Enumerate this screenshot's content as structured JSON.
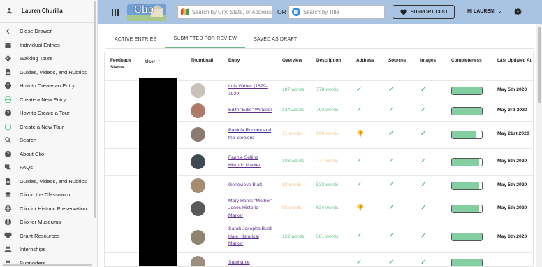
{
  "sidebar": {
    "user_name": "Lauren Churilla",
    "items": [
      {
        "label": "Close Drawer",
        "icon": "chevron-left-icon"
      },
      {
        "label": "Individual Entries",
        "icon": "building-icon"
      },
      {
        "label": "Walking Tours",
        "icon": "direction-sign-icon"
      },
      {
        "label": "Guides, Videos, and Rubrics",
        "icon": "document-icon"
      },
      {
        "label": "How to Create an Entry",
        "icon": "help-circle-icon"
      },
      {
        "label": "Create a New Entry",
        "icon": "add-circle-icon"
      },
      {
        "label": "How to Create a Tour",
        "icon": "help-circle-icon"
      },
      {
        "label": "Create a New Tour",
        "icon": "add-circle-icon"
      },
      {
        "label": "Search",
        "icon": "search-icon"
      },
      {
        "label": "About Clio",
        "icon": "help-circle-icon"
      },
      {
        "label": "FAQs",
        "icon": "forum-icon"
      },
      {
        "label": "Guides, Videos, and Rubrics",
        "icon": "document-icon"
      },
      {
        "label": "Clio in the Classroom",
        "icon": "school-icon"
      },
      {
        "label": "Clio for Historic Preservation",
        "icon": "globe-icon"
      },
      {
        "label": "Clio for Museums",
        "icon": "globe-icon"
      },
      {
        "label": "Grant Resources",
        "icon": "heart-icon"
      },
      {
        "label": "Internships",
        "icon": "people-icon"
      },
      {
        "label": "Supporters",
        "icon": "people-icon"
      }
    ]
  },
  "header": {
    "logo_text": "Clio",
    "search_location_placeholder": "Search by City, State, or Address",
    "or_text": "OR",
    "search_title_placeholder": "Search by Title",
    "support_label": "SUPPORT CLIO",
    "greeting": "HI LAUREN!"
  },
  "tabs": [
    {
      "label": "ACTIVE ENTRIES",
      "active": false
    },
    {
      "label": "SUBMITTED FOR REVIEW",
      "active": true
    },
    {
      "label": "SAVED AS DRAFT",
      "active": false
    }
  ],
  "table": {
    "headers": {
      "feedback": "Feedback Status",
      "user": "User",
      "thumbnail": "Thumbnail",
      "entry": "Entry",
      "overview": "Overview",
      "description": "Description",
      "address": "Address",
      "sources": "Sources",
      "images": "Images",
      "completeness": "Completeness",
      "last_updated": "Last Updated At"
    },
    "rows": [
      {
        "entry": "Lois Weber (1879-1939)",
        "overview": "187 words",
        "overview_ok": true,
        "description": "778 words",
        "description_ok": true,
        "address_ok": true,
        "sources_ok": true,
        "images_ok": true,
        "completeness": 1.0,
        "date": "May 5th 2020",
        "thumb_color": "#c8c2b8"
      },
      {
        "entry": "Edith \"Edie\" Windsor",
        "overview": "134 words",
        "overview_ok": true,
        "description": "793 words",
        "description_ok": true,
        "address_ok": true,
        "sources_ok": true,
        "images_ok": true,
        "completeness": 1.0,
        "date": "May 3rd 2020",
        "thumb_color": "#b07a6a"
      },
      {
        "entry": "Patricia Rooney and the Steelers",
        "overview": "71 words",
        "overview_ok": false,
        "description": "200 words",
        "description_ok": false,
        "address_ok": false,
        "sources_ok": true,
        "images_ok": true,
        "completeness": 0.8,
        "date": "May 21st 2020",
        "thumb_color": "#8a7a70",
        "bold_link": true
      },
      {
        "entry": "Fannie Sellins Historic Marker",
        "overview": "103 words",
        "overview_ok": true,
        "description": "477 words",
        "description_ok": false,
        "address_ok": true,
        "sources_ok": true,
        "images_ok": true,
        "completeness": 0.9,
        "date": "May 6th 2020",
        "thumb_color": "#3d4a52"
      },
      {
        "entry": "Genevieve Blatt",
        "overview": "82 words",
        "overview_ok": false,
        "description": "533 words",
        "description_ok": true,
        "address_ok": true,
        "sources_ok": true,
        "images_ok": true,
        "completeness": 0.9,
        "date": "May 5th 2020",
        "thumb_color": "#a68d70"
      },
      {
        "entry": "Mary Harris \"Mother\" Jones Historic Marker",
        "overview": "92 words",
        "overview_ok": false,
        "description": "634 words",
        "description_ok": true,
        "address_ok": false,
        "sources_ok": true,
        "images_ok": true,
        "completeness": 0.9,
        "date": "May 5th 2020",
        "thumb_color": "#5a5a5a"
      },
      {
        "entry": "Sarah Josepha Buell Hale Historical Marker",
        "overview": "122 words",
        "overview_ok": true,
        "description": "561 words",
        "description_ok": true,
        "address_ok": true,
        "sources_ok": true,
        "images_ok": true,
        "completeness": 1.0,
        "date": "May 6th 2020",
        "thumb_color": "#8e8470"
      },
      {
        "entry": "Stephanie",
        "overview": "",
        "overview_ok": true,
        "description": "",
        "description_ok": true,
        "address_ok": true,
        "sources_ok": true,
        "images_ok": true,
        "completeness": 1.0,
        "date": "",
        "thumb_color": "#9c8d7e"
      }
    ]
  },
  "colors": {
    "header_bg": "#a9c3e3",
    "ok_green": "#5bbf86",
    "warn_orange": "#f2c08c",
    "bar_fill": "#84cfa2",
    "link_purple": "#5d2f8e"
  }
}
